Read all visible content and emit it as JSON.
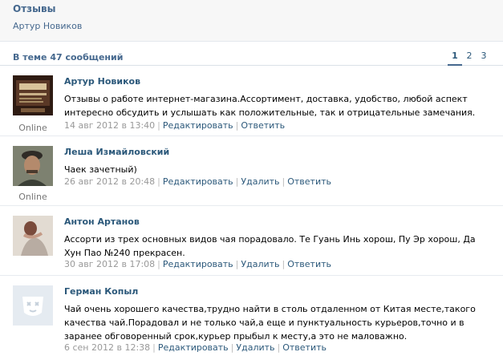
{
  "topic": {
    "title": "Отзывы",
    "author": "Артур Новиков"
  },
  "summary": {
    "text": "В теме 47 сообщений"
  },
  "pager": {
    "pages": [
      "1",
      "2",
      "3"
    ],
    "current": "1"
  },
  "posts": [
    {
      "author": "Артур Новиков",
      "online": "Online",
      "text": "Отзывы о работе интернет-магазина.Ассортимент, доставка, удобство, любой аспект интересно обсудить и услышать как положительные, так и отрицательные замечания.",
      "date": "14 авг 2012 в 13:40",
      "actions": [
        "Редактировать",
        "Ответить"
      ],
      "avatar_text": [
        "Чайный двор",
        "тел. 8-924-39-55"
      ]
    },
    {
      "author": "Леша Измайловский",
      "online": "Online",
      "text": "Чаек зачетный)",
      "date": "26 авг 2012 в 20:48",
      "actions": [
        "Редактировать",
        "Удалить",
        "Ответить"
      ]
    },
    {
      "author": "Антон Артанов",
      "online": "",
      "text": "Ассорти из трех основных видов чая порадовало. Те Гуань Инь хорош, Пу Эр хорош, Да Хун Пао №240 прекрасен.",
      "date": "30 авг 2012 в 17:08",
      "actions": [
        "Редактировать",
        "Удалить",
        "Ответить"
      ]
    },
    {
      "author": "Герман Копыл",
      "online": "",
      "text": "Чай очень хорошего качества,трудно найти в столь отдаленном от Китая месте,такого качества чай.Порадовал и не только чай,а еще и пунктуальность курьеров,точно и в заранее обговоренный срок,курьер прыбыл к месту,а это не маловажно.",
      "date": "6 сен 2012 в 12:38",
      "actions": [
        "Редактировать",
        "Удалить",
        "Ответить"
      ]
    }
  ]
}
